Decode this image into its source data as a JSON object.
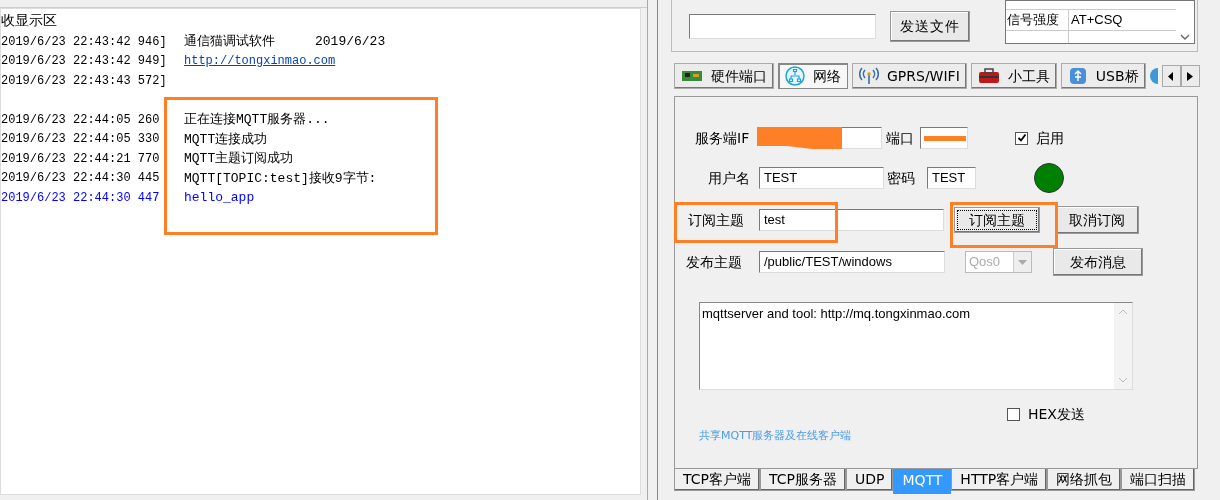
{
  "receive_area": {
    "title": "收显示区",
    "lines": [
      {
        "time": "2019/6/23 22:43:42 946]",
        "parts": [
          "通信猫调试软件",
          "2019/6/23"
        ],
        "kind": "text"
      },
      {
        "time": "2019/6/23 22:43:42 949]",
        "parts": [
          "http://tongxinmao.com"
        ],
        "kind": "link"
      },
      {
        "time": "2019/6/23 22:43:43 572]",
        "kind": "text"
      },
      {
        "kind": "blank"
      },
      {
        "time": "2019/6/23 22:44:05 260",
        "parts": [
          "正在连接MQTT服务器..."
        ],
        "kind": "text"
      },
      {
        "time": "2019/6/23 22:44:05 330",
        "parts": [
          "MQTT连接成功"
        ],
        "kind": "text"
      },
      {
        "time": "2019/6/23 22:44:21 770",
        "parts": [
          "MQTT主题订阅成功"
        ],
        "kind": "text"
      },
      {
        "time": "2019/6/23 22:44:30 445",
        "parts": [
          "MQTT[TOPIC:test]接收9字节:"
        ],
        "kind": "text"
      },
      {
        "time": "2019/6/23 22:44:30 447",
        "parts": [
          "hello_app"
        ],
        "kind": "received"
      }
    ]
  },
  "send_file_button": "发送文件",
  "at_table": {
    "rows": [
      [
        "信号强度",
        "AT+CSQ"
      ]
    ]
  },
  "top_tabs": [
    {
      "label": "硬件端口",
      "selected": false
    },
    {
      "label": "网络",
      "selected": true
    },
    {
      "label": "GPRS/WIFI",
      "selected": false
    },
    {
      "label": "小工具",
      "selected": false
    },
    {
      "label": "USB桥",
      "selected": false
    }
  ],
  "mqtt_form": {
    "server_ip_label": "服务端IF",
    "port_label": "端口",
    "enable": {
      "label": "启用",
      "checked": true
    },
    "user_label": "用户名",
    "user": "TEST",
    "password_label": "密码",
    "password": "TEST",
    "subscribe_label": "订阅主题",
    "subscribe_topic": "test",
    "subscribe_button": "订阅主题",
    "unsubscribe_button": "取消订阅",
    "publish_label": "发布主题",
    "publish_topic": "/public/TEST/windows",
    "qos": {
      "value": "Qos0",
      "disabled": true
    },
    "publish_button": "发布消息",
    "message": "mqttserver and tool: http://mq.tongxinmao.com",
    "hex_send": {
      "label": "HEX发送",
      "checked": false
    },
    "share_link": "共享MQTT服务器及在线客户端"
  },
  "bottom_tabs": [
    {
      "label": "TCP客户端",
      "selected": false
    },
    {
      "label": "TCP服务器",
      "selected": false
    },
    {
      "label": "UDP",
      "selected": false
    },
    {
      "label": "MQTT",
      "selected": true
    },
    {
      "label": "HTTP客户端",
      "selected": false
    },
    {
      "label": "网络抓包",
      "selected": false
    },
    {
      "label": "端口扫描",
      "selected": false
    }
  ]
}
